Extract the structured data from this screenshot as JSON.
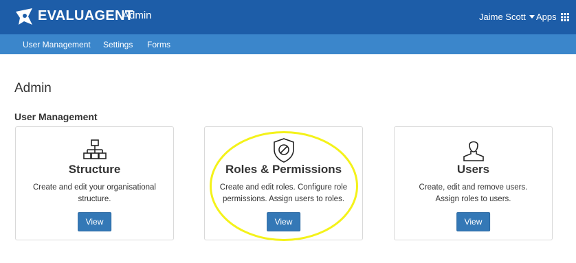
{
  "header": {
    "brand": "EVALUAGENT",
    "section": "Admin",
    "user_name": "Jaime Scott",
    "apps_label": "Apps",
    "background_color": "#1d5da8"
  },
  "subnav": {
    "background_color": "#3b86cb",
    "items": [
      {
        "label": "User Management"
      },
      {
        "label": "Settings"
      },
      {
        "label": "Forms"
      }
    ]
  },
  "main": {
    "page_title": "Admin",
    "group_title": "User Management",
    "cards": [
      {
        "icon": "org-chart-icon",
        "title": "Structure",
        "description": "Create and edit your organisational structure.",
        "button_label": "View"
      },
      {
        "icon": "shield-icon",
        "title": "Roles & Permissions",
        "description": "Create and edit roles. Configure role permissions. Assign users to roles.",
        "button_label": "View"
      },
      {
        "icon": "user-icon",
        "title": "Users",
        "description": "Create, edit and remove users. Assign roles to users.",
        "button_label": "View"
      }
    ],
    "highlight_color": "#f4f21a"
  }
}
